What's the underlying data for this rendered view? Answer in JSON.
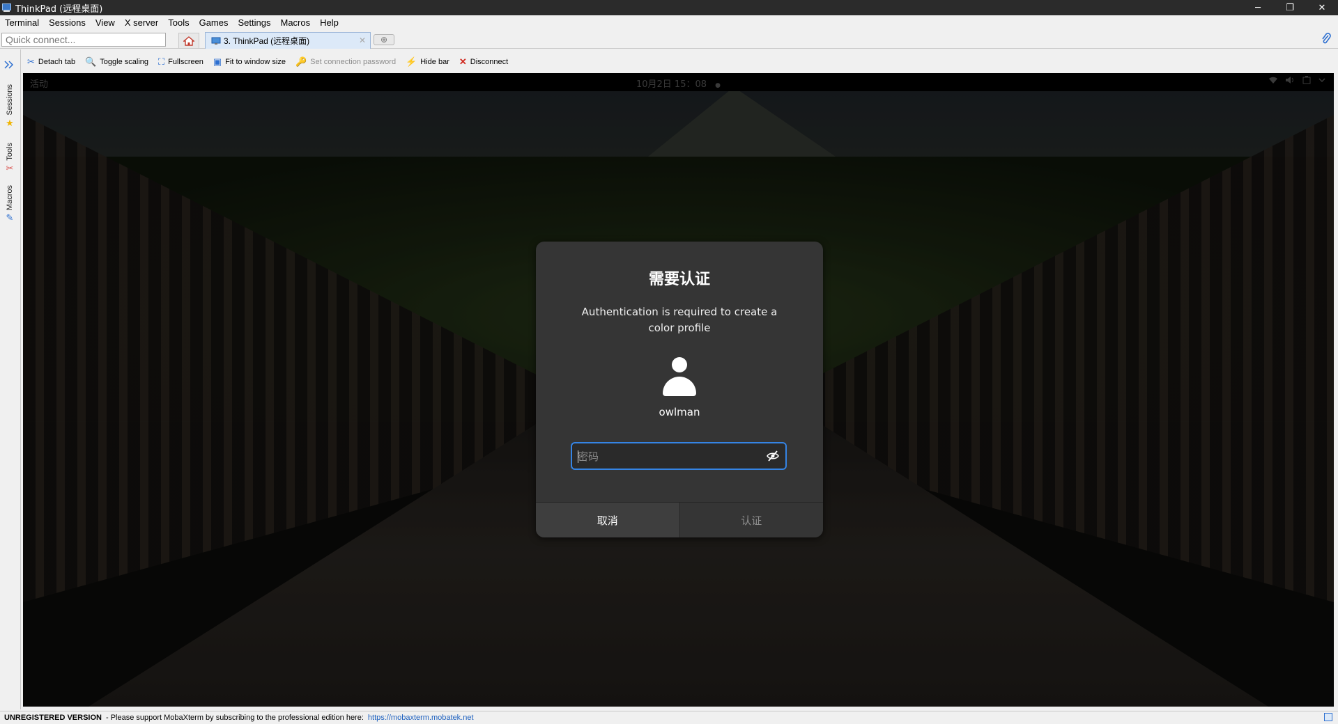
{
  "window": {
    "title": "ThinkPad (远程桌面)",
    "controls": {
      "minimize": "─",
      "restore": "❐",
      "close": "✕"
    }
  },
  "menubar": {
    "items": [
      "Terminal",
      "Sessions",
      "View",
      "X server",
      "Tools",
      "Games",
      "Settings",
      "Macros",
      "Help"
    ]
  },
  "tabbar": {
    "quick_connect_placeholder": "Quick connect...",
    "active_tab_label": "3. ThinkPad (远程桌面)",
    "active_tab_close": "✕",
    "new_tab": "⊕"
  },
  "sidepanel": {
    "tabs": [
      "Sessions",
      "Tools",
      "Macros"
    ]
  },
  "toolbar": {
    "buttons": [
      "Detach tab",
      "Toggle scaling",
      "Fullscreen",
      "Fit to window size",
      "Set connection password",
      "Hide bar",
      "Disconnect"
    ]
  },
  "remote": {
    "topbar": {
      "activities": "活动",
      "clock": "10月2日 15：08",
      "notification_dot": "●"
    },
    "dialog": {
      "title": "需要认证",
      "message": "Authentication is required to create a color profile",
      "username": "owlman",
      "password_placeholder": "密码",
      "cancel_label": "取消",
      "authenticate_label": "认证"
    }
  },
  "statusbar": {
    "unregistered": "UNREGISTERED VERSION",
    "message": " -  Please support MobaXterm by subscribing to the professional edition here:",
    "link": "https://mobaxterm.mobatek.net"
  },
  "colors": {
    "accent": "#3584e4",
    "dialog_bg": "#353535",
    "link": "#1b5fbf"
  }
}
